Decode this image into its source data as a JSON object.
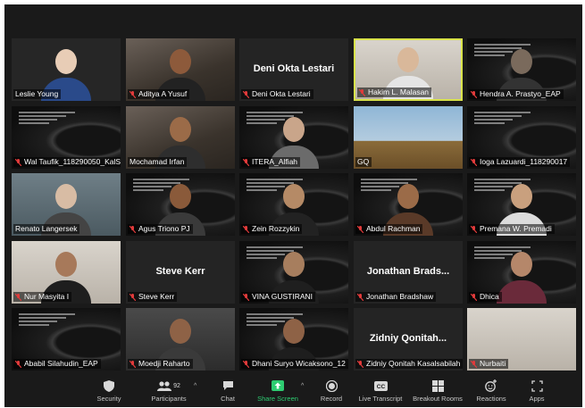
{
  "app": {
    "name": "Zoom meeting gallery view"
  },
  "participants": [
    {
      "name": "Leslie Young",
      "display_name": "",
      "muted": false,
      "video": "bg-dark",
      "skin": "#e8cdb6",
      "shirt": "#2a4a8a",
      "active": false
    },
    {
      "name": "Aditya A Yusuf",
      "display_name": "",
      "muted": true,
      "video": "bg-room",
      "skin": "#8d5a3b",
      "shirt": "#222222",
      "active": false
    },
    {
      "name": "Deni Okta Lestari",
      "display_name": "Deni Okta Lestari",
      "muted": true,
      "video": "none",
      "active": false
    },
    {
      "name": "Hakim L. Malasan",
      "display_name": "",
      "muted": true,
      "video": "bg-light",
      "skin": "#d9b89a",
      "shirt": "#e5e5e5",
      "active": true
    },
    {
      "name": "Hendra A. Prastyo_EAP",
      "display_name": "",
      "muted": true,
      "video": "bg-space",
      "skin": "#7a6a5c",
      "shirt": "#333333",
      "active": false
    },
    {
      "name": "Wal Taufik_118290050_KalSis",
      "display_name": "",
      "muted": true,
      "video": "bg-space",
      "active": false
    },
    {
      "name": "Mochamad Irfan",
      "display_name": "",
      "muted": false,
      "video": "bg-room",
      "skin": "#9b6b48",
      "shirt": "#2e2e2e",
      "active": false
    },
    {
      "name": "ITERA_Alfiah",
      "display_name": "",
      "muted": true,
      "video": "bg-space",
      "skin": "#c9a58a",
      "shirt": "#6b6b6b",
      "active": false
    },
    {
      "name": "GQ",
      "display_name": "",
      "muted": false,
      "video": "bg-sky",
      "active": false
    },
    {
      "name": "Ioga Lazuardi_118290017",
      "display_name": "",
      "muted": true,
      "video": "bg-space",
      "active": false
    },
    {
      "name": "Renato Langersek",
      "display_name": "",
      "muted": false,
      "video": "bg-chart",
      "skin": "#d8bca4",
      "shirt": "#444444",
      "active": false
    },
    {
      "name": "Agus Triono PJ",
      "display_name": "",
      "muted": true,
      "video": "bg-space",
      "skin": "#8a5a3a",
      "shirt": "#3a3a3a",
      "active": false
    },
    {
      "name": "Zein Rozzykin",
      "display_name": "",
      "muted": true,
      "video": "bg-space",
      "skin": "#b58a66",
      "shirt": "#222222",
      "active": false
    },
    {
      "name": "Abdul Rachman",
      "display_name": "",
      "muted": true,
      "video": "bg-space",
      "skin": "#9b6b48",
      "shirt": "#5a3a28",
      "active": false
    },
    {
      "name": "Premana W. Premadi",
      "display_name": "",
      "muted": true,
      "video": "bg-space",
      "skin": "#c9a07e",
      "shirt": "#dcdcdc",
      "active": false
    },
    {
      "name": "Nur Masyita I",
      "display_name": "",
      "muted": true,
      "video": "bg-light",
      "skin": "#a7795a",
      "shirt": "#1e1e1e",
      "active": false
    },
    {
      "name": "Steve Kerr",
      "display_name": "Steve Kerr",
      "muted": true,
      "video": "none",
      "active": false
    },
    {
      "name": "VINA GUSTIRANI",
      "display_name": "",
      "muted": true,
      "video": "bg-space",
      "skin": "#a77e5e",
      "shirt": "#1f1f1f",
      "active": false
    },
    {
      "name": "Jonathan Bradshaw",
      "display_name": "Jonathan Brads...",
      "muted": true,
      "video": "none",
      "active": false
    },
    {
      "name": "Dhica",
      "display_name": "",
      "muted": true,
      "video": "bg-space",
      "skin": "#b5876a",
      "shirt": "#6a2a3a",
      "active": false
    },
    {
      "name": "Ababil Silahudin_EAP",
      "display_name": "",
      "muted": true,
      "video": "bg-space",
      "active": false
    },
    {
      "name": "Moedji Raharto",
      "display_name": "",
      "muted": true,
      "video": "bg-wall",
      "skin": "#8e6246",
      "shirt": "#3a3a3a",
      "active": false
    },
    {
      "name": "Dhani Suryo Wicaksono_12",
      "display_name": "",
      "muted": true,
      "video": "bg-space",
      "skin": "#8e6246",
      "shirt": "#1e1e1e",
      "active": false
    },
    {
      "name": "Zidniy Qonitah Kasalsabilah",
      "display_name": "Zidniy Qonitah...",
      "muted": true,
      "video": "none",
      "active": false
    },
    {
      "name": "Nurbaiti",
      "display_name": "",
      "muted": true,
      "video": "bg-light",
      "active": false
    }
  ],
  "toolbar": {
    "security_label": "Security",
    "participants_label": "Participants",
    "participants_count": "92",
    "chat_label": "Chat",
    "share_label": "Share Screen",
    "record_label": "Record",
    "transcript_label": "Live Transcript",
    "breakout_label": "Breakout Rooms",
    "reactions_label": "Reactions",
    "apps_label": "Apps"
  },
  "colors": {
    "muted_icon": "#e23b3b",
    "active_border": "#d8e24a",
    "share_green": "#2ecc71",
    "background": "#1a1a1a"
  }
}
